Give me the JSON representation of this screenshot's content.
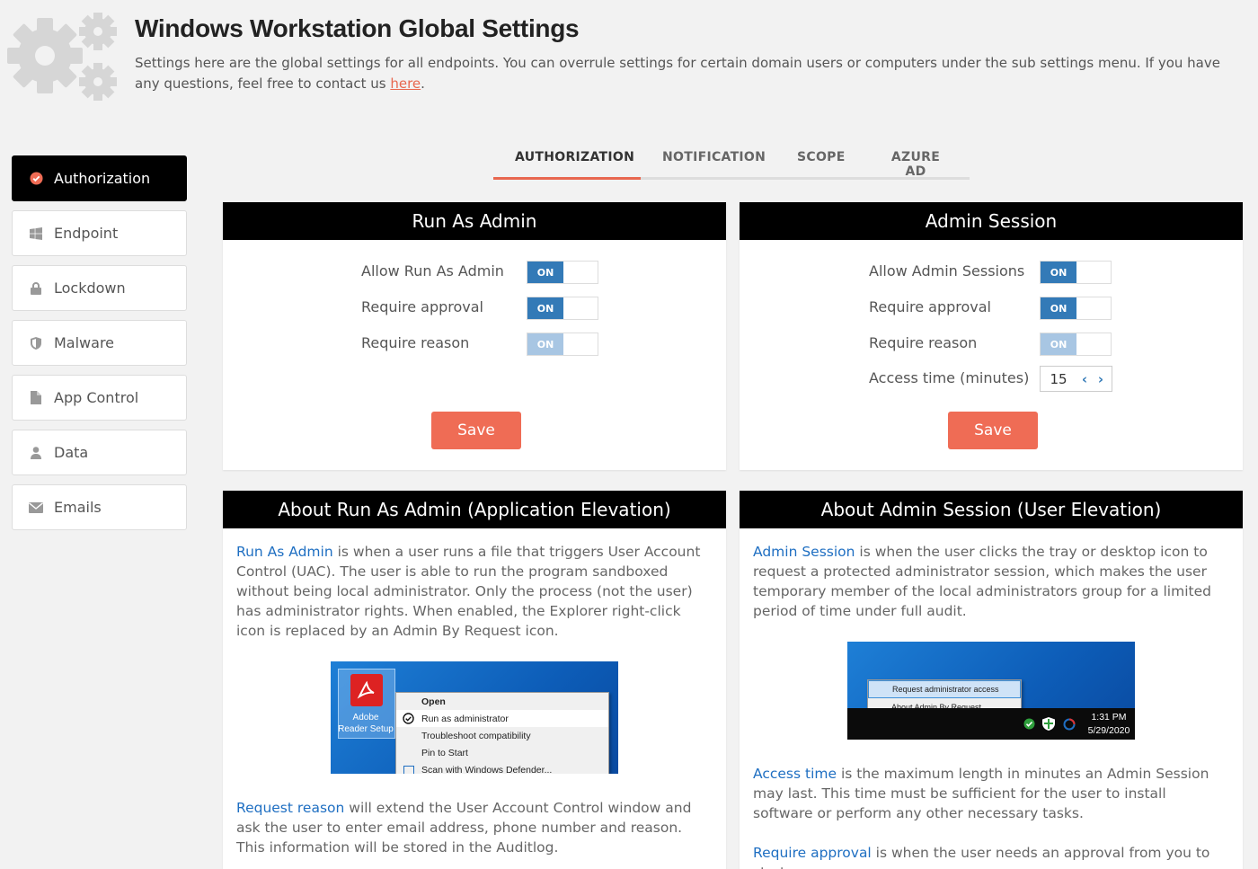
{
  "header": {
    "title": "Windows Workstation Global Settings",
    "description": "Settings here are the global settings for all endpoints. You can overrule settings for certain domain users or computers under the sub settings menu. If you have any questions, feel free to contact us ",
    "link_text": "here",
    "after_link": "."
  },
  "sidebar": {
    "items": [
      {
        "label": "Authorization",
        "icon": "check-circle-icon",
        "active": true
      },
      {
        "label": "Endpoint",
        "icon": "windows-icon"
      },
      {
        "label": "Lockdown",
        "icon": "lock-icon"
      },
      {
        "label": "Malware",
        "icon": "shield-icon"
      },
      {
        "label": "App Control",
        "icon": "file-icon"
      },
      {
        "label": "Data",
        "icon": "user-icon"
      },
      {
        "label": "Emails",
        "icon": "envelope-icon"
      }
    ]
  },
  "tabs": [
    {
      "label": "AUTHORIZATION",
      "active": true
    },
    {
      "label": "NOTIFICATION"
    },
    {
      "label": "SCOPE"
    },
    {
      "label": "AZURE AD"
    }
  ],
  "run_as_admin": {
    "title": "Run As Admin",
    "settings": [
      {
        "label": "Allow Run As Admin",
        "state": "ON"
      },
      {
        "label": "Require approval",
        "state": "ON"
      },
      {
        "label": "Require reason",
        "state": "ON",
        "disabled": true
      }
    ],
    "save_label": "Save"
  },
  "admin_session": {
    "title": "Admin Session",
    "settings": [
      {
        "label": "Allow Admin Sessions",
        "state": "ON"
      },
      {
        "label": "Require approval",
        "state": "ON"
      },
      {
        "label": "Require reason",
        "state": "ON",
        "disabled": true
      }
    ],
    "access_time_label": "Access time (minutes)",
    "access_time_value": "15",
    "save_label": "Save"
  },
  "about_run_as_admin": {
    "title": "About Run As Admin (Application Elevation)",
    "p1_term": "Run As Admin",
    "p1_text": " is when a user runs a file that triggers User Account Control (UAC). The user is able to run the program sandboxed without being local administrator. Only the process (not the user) has administrator rights. When enabled, the Explorer right-click icon is replaced by an Admin By Request icon.",
    "p2_term": "Request reason",
    "p2_text": " will extend the User Account Control window and ask the user to enter email address, phone number and reason. This information will be stored in the Auditlog.",
    "screenshot": {
      "desktop_icon_label_1": "Adobe",
      "desktop_icon_label_2": "Reader Setup",
      "menu": [
        "Open",
        "Run as administrator",
        "Troubleshoot compatibility",
        "Pin to Start",
        "Scan with Windows Defender..."
      ]
    }
  },
  "about_admin_session": {
    "title": "About Admin Session (User Elevation)",
    "p1_term": "Admin Session",
    "p1_text": " is when the user clicks the tray or desktop icon to request a protected administrator session, which makes the user temporary member of the local administrators group for a limited period of time under full audit.",
    "p2_term": "Access time",
    "p2_text": " is the maximum length in minutes an Admin Session may last. This time must be sufficient for the user to install software or perform any other necessary tasks.",
    "p3_term": "Require approval",
    "p3_text": " is when the user needs an approval from you to start.",
    "screenshot": {
      "menu": [
        "Request administrator access",
        "About Admin By Request"
      ],
      "time": "1:31 PM",
      "date": "5/29/2020"
    }
  },
  "colors": {
    "accent": "#ef6c55",
    "toggle_on": "#337ab7",
    "link_blue": "#1f6fc2"
  }
}
